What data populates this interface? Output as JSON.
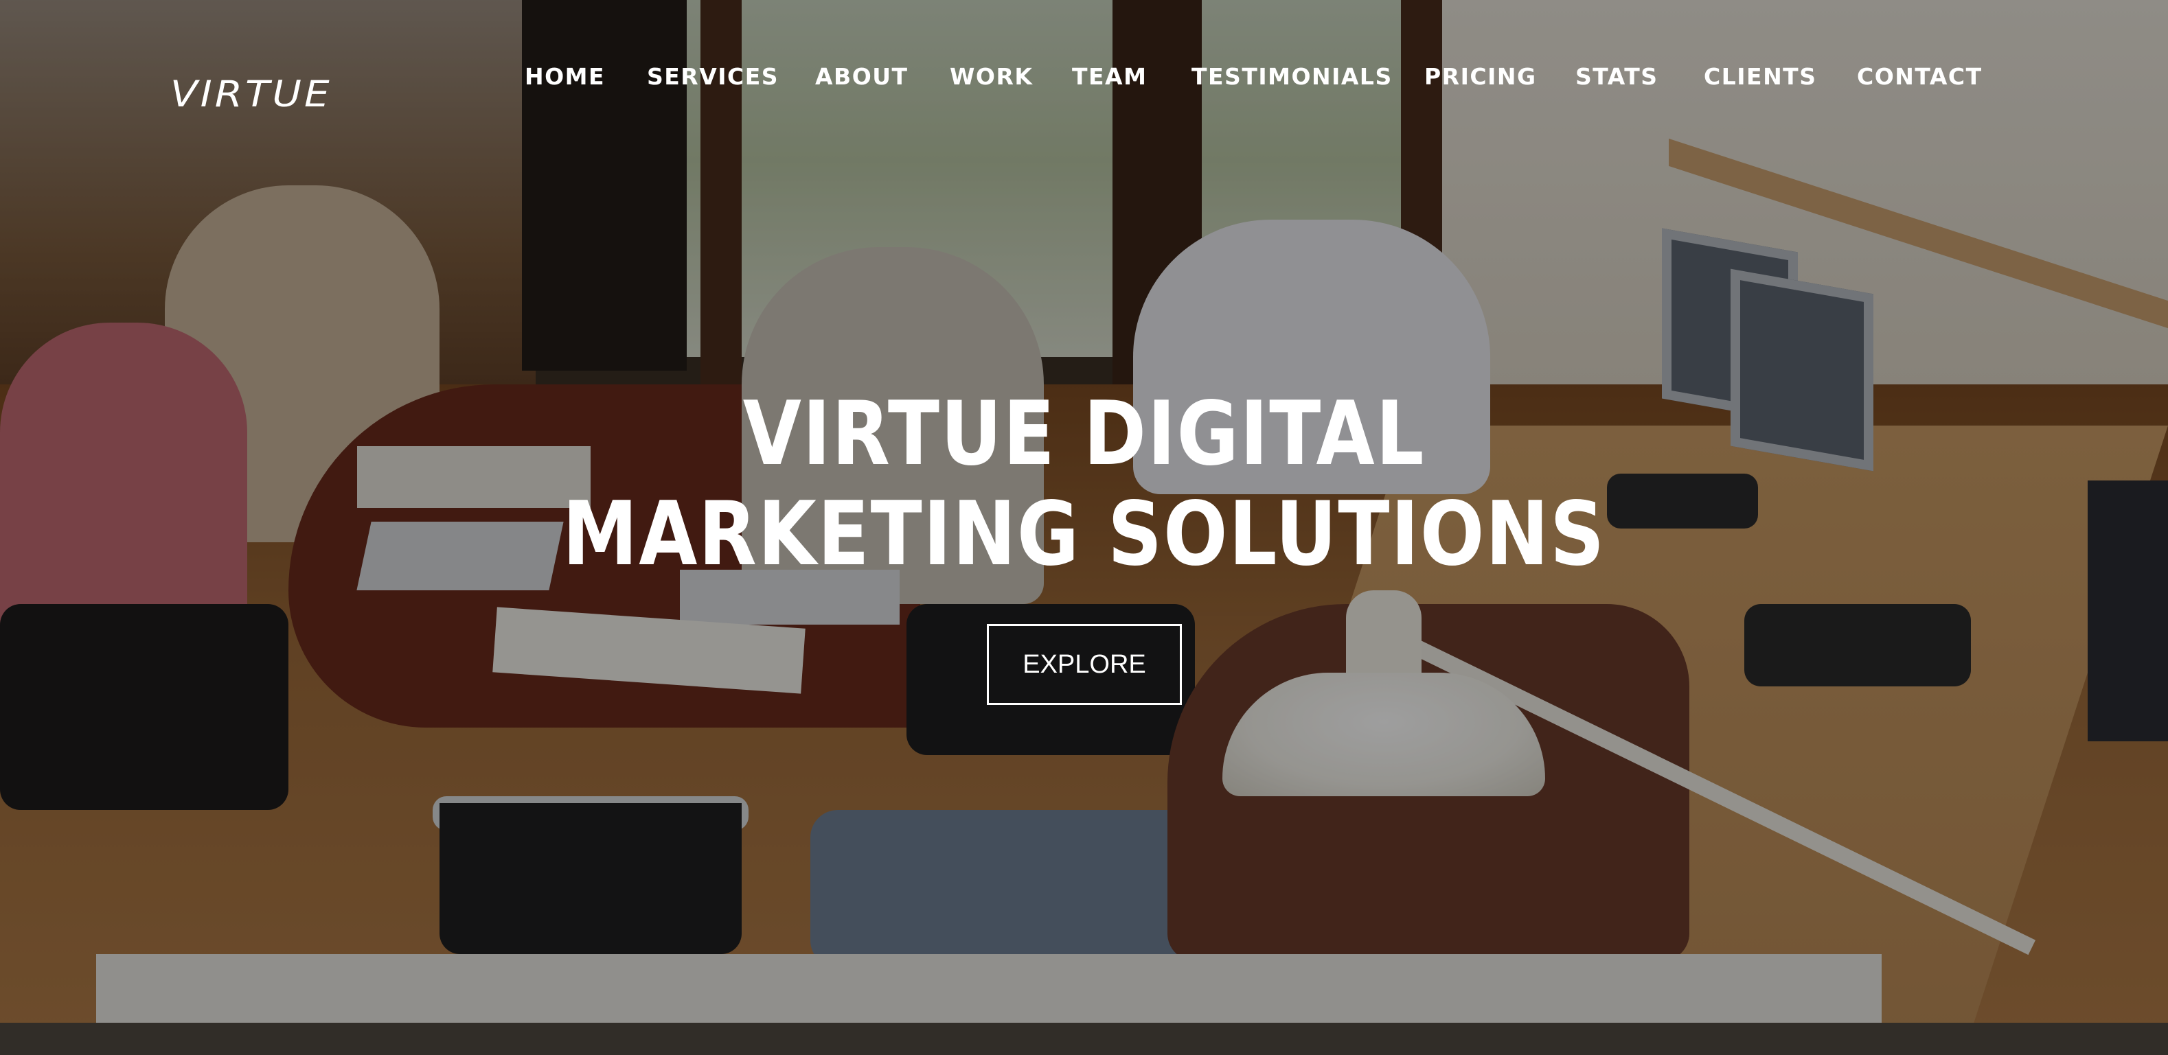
{
  "brand": {
    "logo_text": "Virtue"
  },
  "nav": {
    "items": [
      {
        "label": "Home"
      },
      {
        "label": "Services"
      },
      {
        "label": "About"
      },
      {
        "label": "Work"
      },
      {
        "label": "Team"
      },
      {
        "label": "Testimonials"
      },
      {
        "label": "Pricing"
      },
      {
        "label": "Stats"
      },
      {
        "label": "Clients"
      },
      {
        "label": "Contact"
      }
    ]
  },
  "hero": {
    "headline_line1": "Virtue Digital",
    "headline_line2": "Marketing Solutions",
    "cta_label": "Explore",
    "background_description_icon": "office-photo-background"
  },
  "colors": {
    "text": "#ffffff",
    "overlay": "rgba(0,0,0,0.38)"
  }
}
